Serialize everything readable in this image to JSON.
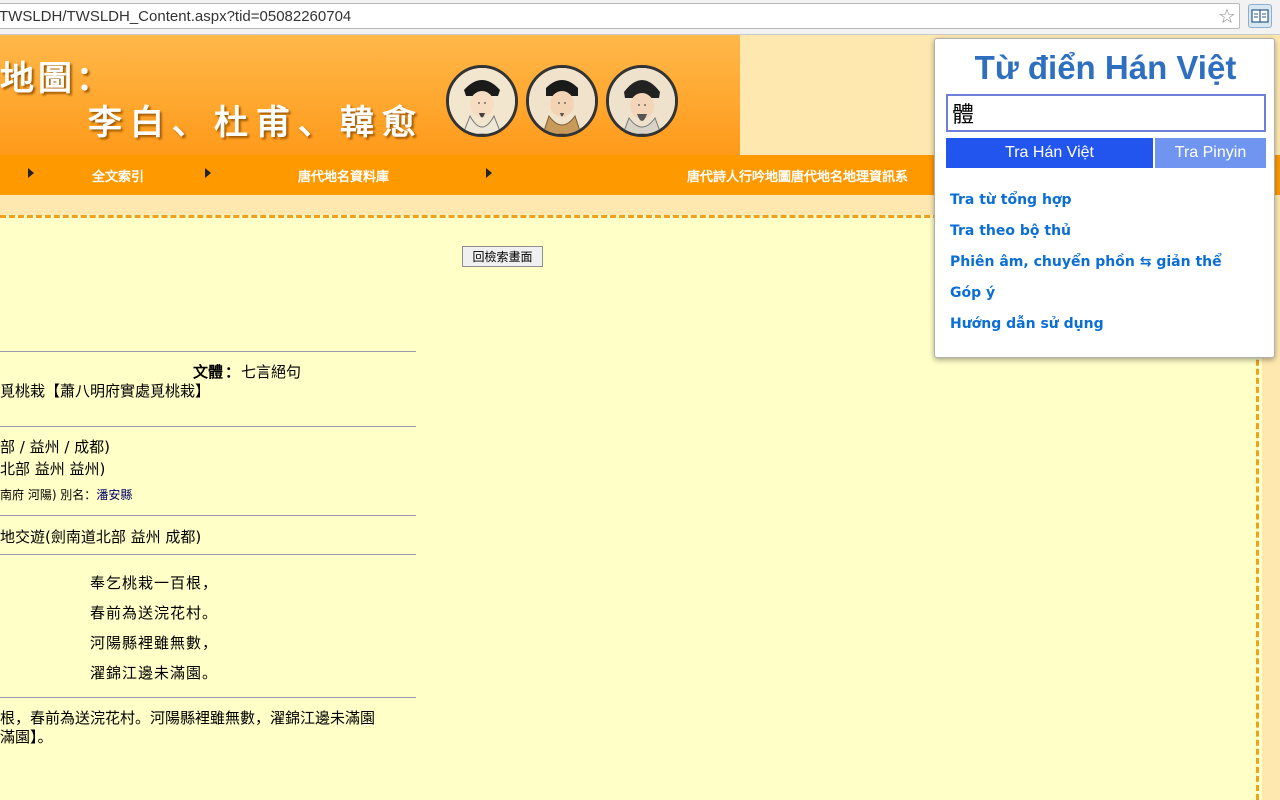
{
  "browser": {
    "url": "TWSLDH/TWSLDH_Content.aspx?tid=05082260704",
    "star_icon": "star-icon",
    "extension_icon": "dictionary-extension-icon"
  },
  "banner": {
    "title": "地圖：",
    "poets": "李白、杜甫、韓愈"
  },
  "nav": {
    "items": [
      "全文索引",
      "唐代地名資料庫",
      "唐代詩人行吟地圖唐代地名地理資訊系"
    ]
  },
  "content": {
    "back_button": "回檢索畫面",
    "genre_label": "文體",
    "genre_value": "七言絕句",
    "title_line": "覓桃栽【蕭八明府實處覓桃栽】",
    "place_line_1": "部 / 益州 / 成都)",
    "place_line_2": "北部 益州 益州)",
    "place_line_3_prefix": "南府 河陽) 別名：",
    "place_line_3_alias": "潘安縣",
    "travel_line": "地交遊(劍南道北部 益州 成都)",
    "poem_lines": [
      "奉乞桃栽一百根，",
      "春前為送浣花村。",
      "河陽縣裡雖無數，",
      "濯錦江邊未滿園。"
    ],
    "fulltext_1": "根，春前為送浣花村。河陽縣裡雖無數，濯錦江邊未滿園",
    "fulltext_2": "滿園】。"
  },
  "dictionary": {
    "title": "Từ điển Hán Việt",
    "input_value": "體",
    "btn_han_viet": "Tra Hán Việt",
    "btn_pinyin": "Tra Pinyin",
    "links": [
      "Tra từ tổng hợp",
      "Tra theo bộ thủ",
      "Phiên âm, chuyển phồn ⇆ giản thể",
      "Góp ý",
      "Hướng dẫn sử dụng"
    ]
  }
}
